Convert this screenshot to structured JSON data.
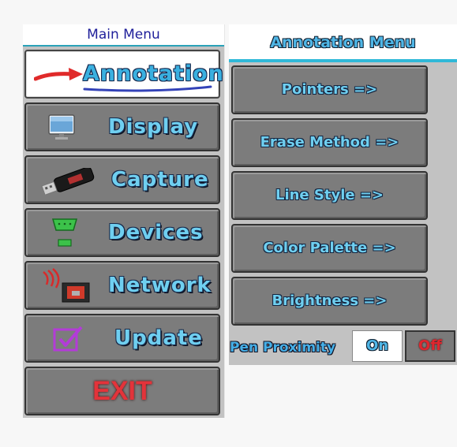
{
  "main_menu": {
    "title": "Main Menu",
    "items": [
      {
        "label": "Annotation",
        "icon": "red-arrow-icon",
        "active": true
      },
      {
        "label": "Display",
        "icon": "monitor-icon"
      },
      {
        "label": "Capture",
        "icon": "usb-capture-stick-icon"
      },
      {
        "label": "Devices",
        "icon": "serial-port-icon"
      },
      {
        "label": "Network",
        "icon": "network-wireless-icon"
      },
      {
        "label": "Update",
        "icon": "checkbox-icon"
      }
    ],
    "exit_label": "EXIT"
  },
  "annotation_menu": {
    "title": "Annotation Menu",
    "items": [
      {
        "label": "Pointers =>"
      },
      {
        "label": "Erase Method =>"
      },
      {
        "label": "Line Style =>"
      },
      {
        "label": "Color Palette =>"
      },
      {
        "label": "Brightness =>"
      }
    ],
    "pen_proximity": {
      "label": "Pen Proximity",
      "on_label": "On",
      "off_label": "Off",
      "selected": "On"
    }
  },
  "colors": {
    "accent_cyan": "#2fb8d8",
    "label_blue": "#6fcff0",
    "exit_red": "#e3333a",
    "button_gray": "#7c7c7c"
  }
}
